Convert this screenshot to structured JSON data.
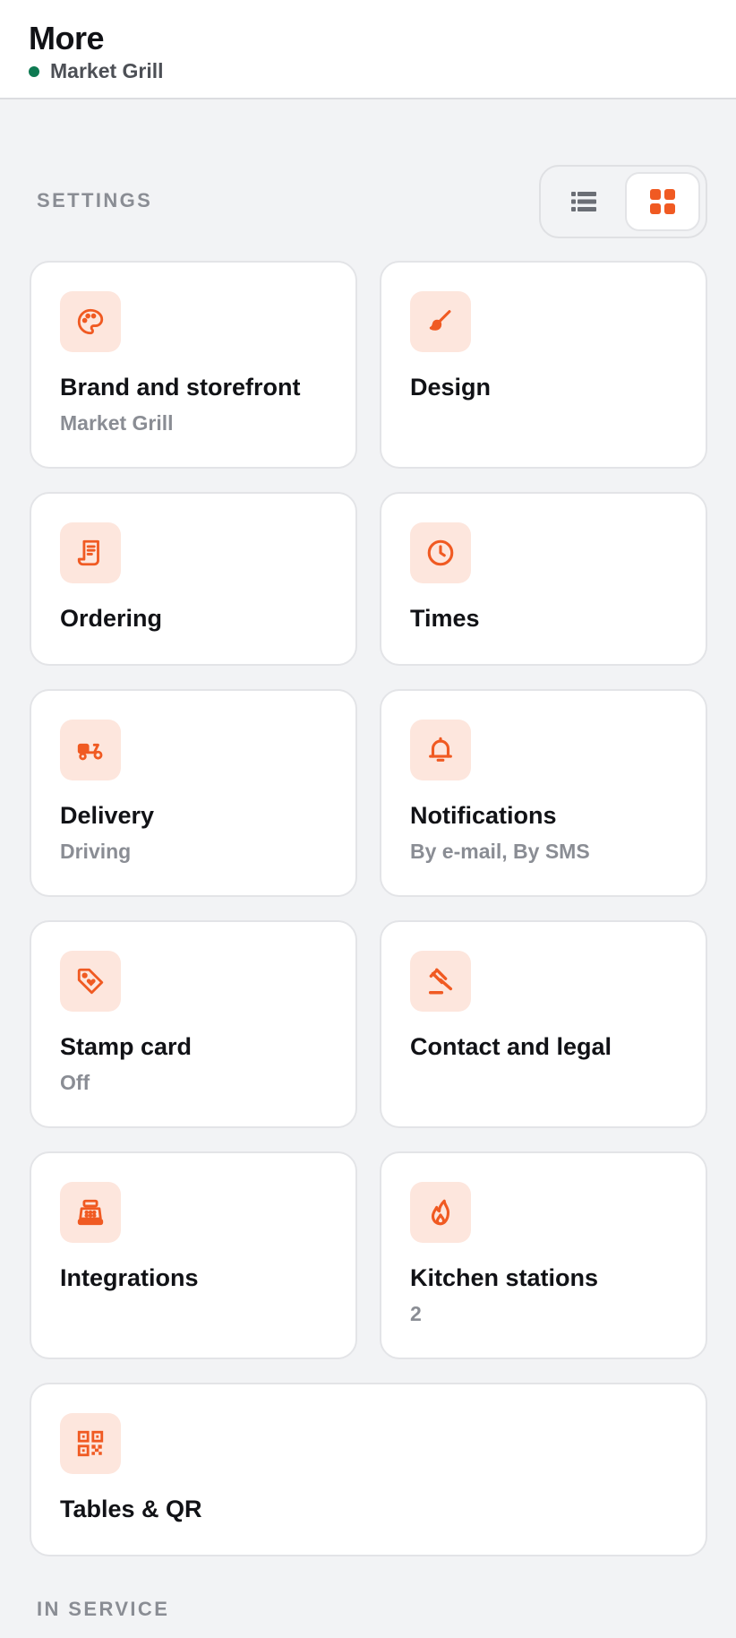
{
  "header": {
    "title": "More",
    "store_name": "Market Grill",
    "status_color": "#0e7a52"
  },
  "settings_section": {
    "label": "SETTINGS"
  },
  "view_toggle": {
    "list_icon": "list-icon",
    "grid_icon": "grid-icon",
    "selected": "grid"
  },
  "accent_color": "#f05a22",
  "cards": [
    {
      "label": "Brand and storefront",
      "subtitle": "Market Grill",
      "icon": "palette-icon"
    },
    {
      "label": "Design",
      "subtitle": "",
      "icon": "brush-icon"
    },
    {
      "label": "Ordering",
      "subtitle": "",
      "icon": "receipt-icon"
    },
    {
      "label": "Times",
      "subtitle": "",
      "icon": "clock-icon"
    },
    {
      "label": "Delivery",
      "subtitle": "Driving",
      "icon": "scooter-icon"
    },
    {
      "label": "Notifications",
      "subtitle": "By e-mail, By SMS",
      "icon": "bell-icon"
    },
    {
      "label": "Stamp card",
      "subtitle": "Off",
      "icon": "tag-heart-icon"
    },
    {
      "label": "Contact and legal",
      "subtitle": "",
      "icon": "gavel-icon"
    },
    {
      "label": "Integrations",
      "subtitle": "",
      "icon": "cash-register-icon"
    },
    {
      "label": "Kitchen stations",
      "subtitle": "2",
      "icon": "flame-icon"
    },
    {
      "label": "Tables & QR",
      "subtitle": "",
      "icon": "qr-code-icon"
    }
  ],
  "in_service_section": {
    "label": "IN SERVICE"
  }
}
